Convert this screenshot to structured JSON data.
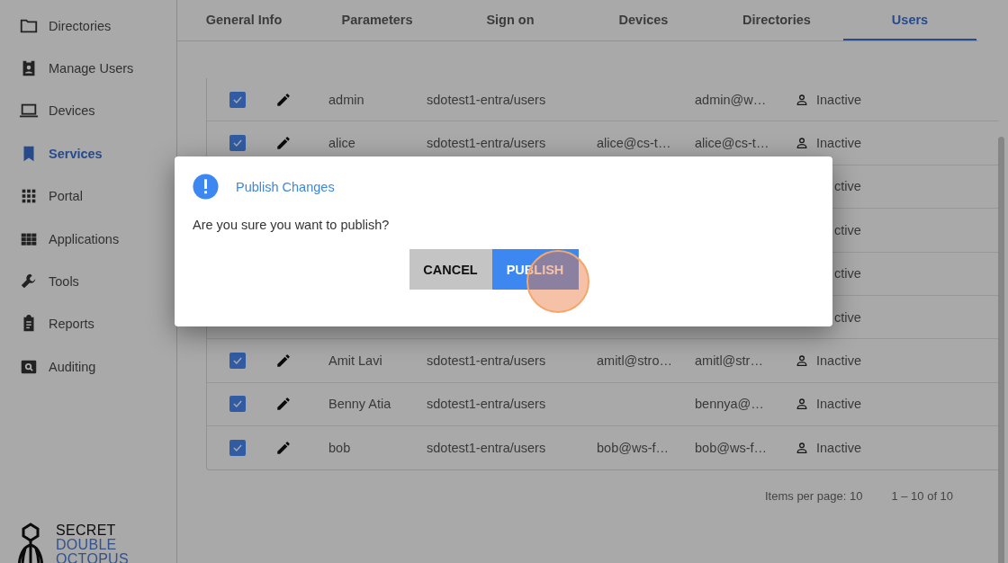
{
  "sidebar": {
    "items": [
      {
        "label": "Directories",
        "selected": false
      },
      {
        "label": "Manage Users",
        "selected": false
      },
      {
        "label": "Devices",
        "selected": false
      },
      {
        "label": "Services",
        "selected": true
      },
      {
        "label": "Portal",
        "selected": false
      },
      {
        "label": "Applications",
        "selected": false
      },
      {
        "label": "Tools",
        "selected": false
      },
      {
        "label": "Reports",
        "selected": false
      },
      {
        "label": "Auditing",
        "selected": false
      }
    ],
    "logo": [
      "SECRET",
      "DOUBLE",
      "OCTOPUS"
    ]
  },
  "tabs": [
    {
      "label": "General Info",
      "selected": false
    },
    {
      "label": "Parameters",
      "selected": false
    },
    {
      "label": "Sign on",
      "selected": false
    },
    {
      "label": "Devices",
      "selected": false
    },
    {
      "label": "Directories",
      "selected": false
    },
    {
      "label": "Users",
      "selected": true
    }
  ],
  "table": {
    "rows": [
      {
        "kind": "row",
        "checked": true,
        "name": "admin",
        "path": "sdotest1-entra/users",
        "column_5": "",
        "column_6": "admin@w…",
        "status": "Inactive"
      },
      {
        "kind": "row",
        "checked": true,
        "name": "alice",
        "path": "sdotest1-entra/users",
        "column_5": "alice@cs-t…",
        "column_6": "alice@cs-t…",
        "status": "Inactive"
      },
      {
        "kind": "covered",
        "status": "ctive"
      },
      {
        "kind": "covered",
        "status": "ctive"
      },
      {
        "kind": "covered",
        "status": "ctive"
      },
      {
        "kind": "covered",
        "status": "ctive"
      },
      {
        "kind": "row",
        "checked": true,
        "name": "Amit Lavi",
        "path": "sdotest1-entra/users",
        "column_5": "amitl@stro…",
        "column_6": "amitl@str…",
        "status": "Inactive"
      },
      {
        "kind": "row",
        "checked": true,
        "name": "Benny Atia",
        "path": "sdotest1-entra/users",
        "column_5": "",
        "column_6": "bennya@…",
        "status": "Inactive"
      },
      {
        "kind": "row",
        "checked": true,
        "name": "bob",
        "path": "sdotest1-entra/users",
        "column_5": "bob@ws-f…",
        "column_6": "bob@ws-f…",
        "status": "Inactive"
      }
    ]
  },
  "pagination": {
    "items_per_page": "Items per page: 10",
    "range": "1 – 10 of 10"
  },
  "dialog": {
    "title": "Publish Changes",
    "message": "Are you sure you want to publish?",
    "buttons": [
      {
        "label": "CANCEL",
        "kind": "cancel"
      },
      {
        "label": "PUBLISH",
        "kind": "primary"
      }
    ]
  }
}
